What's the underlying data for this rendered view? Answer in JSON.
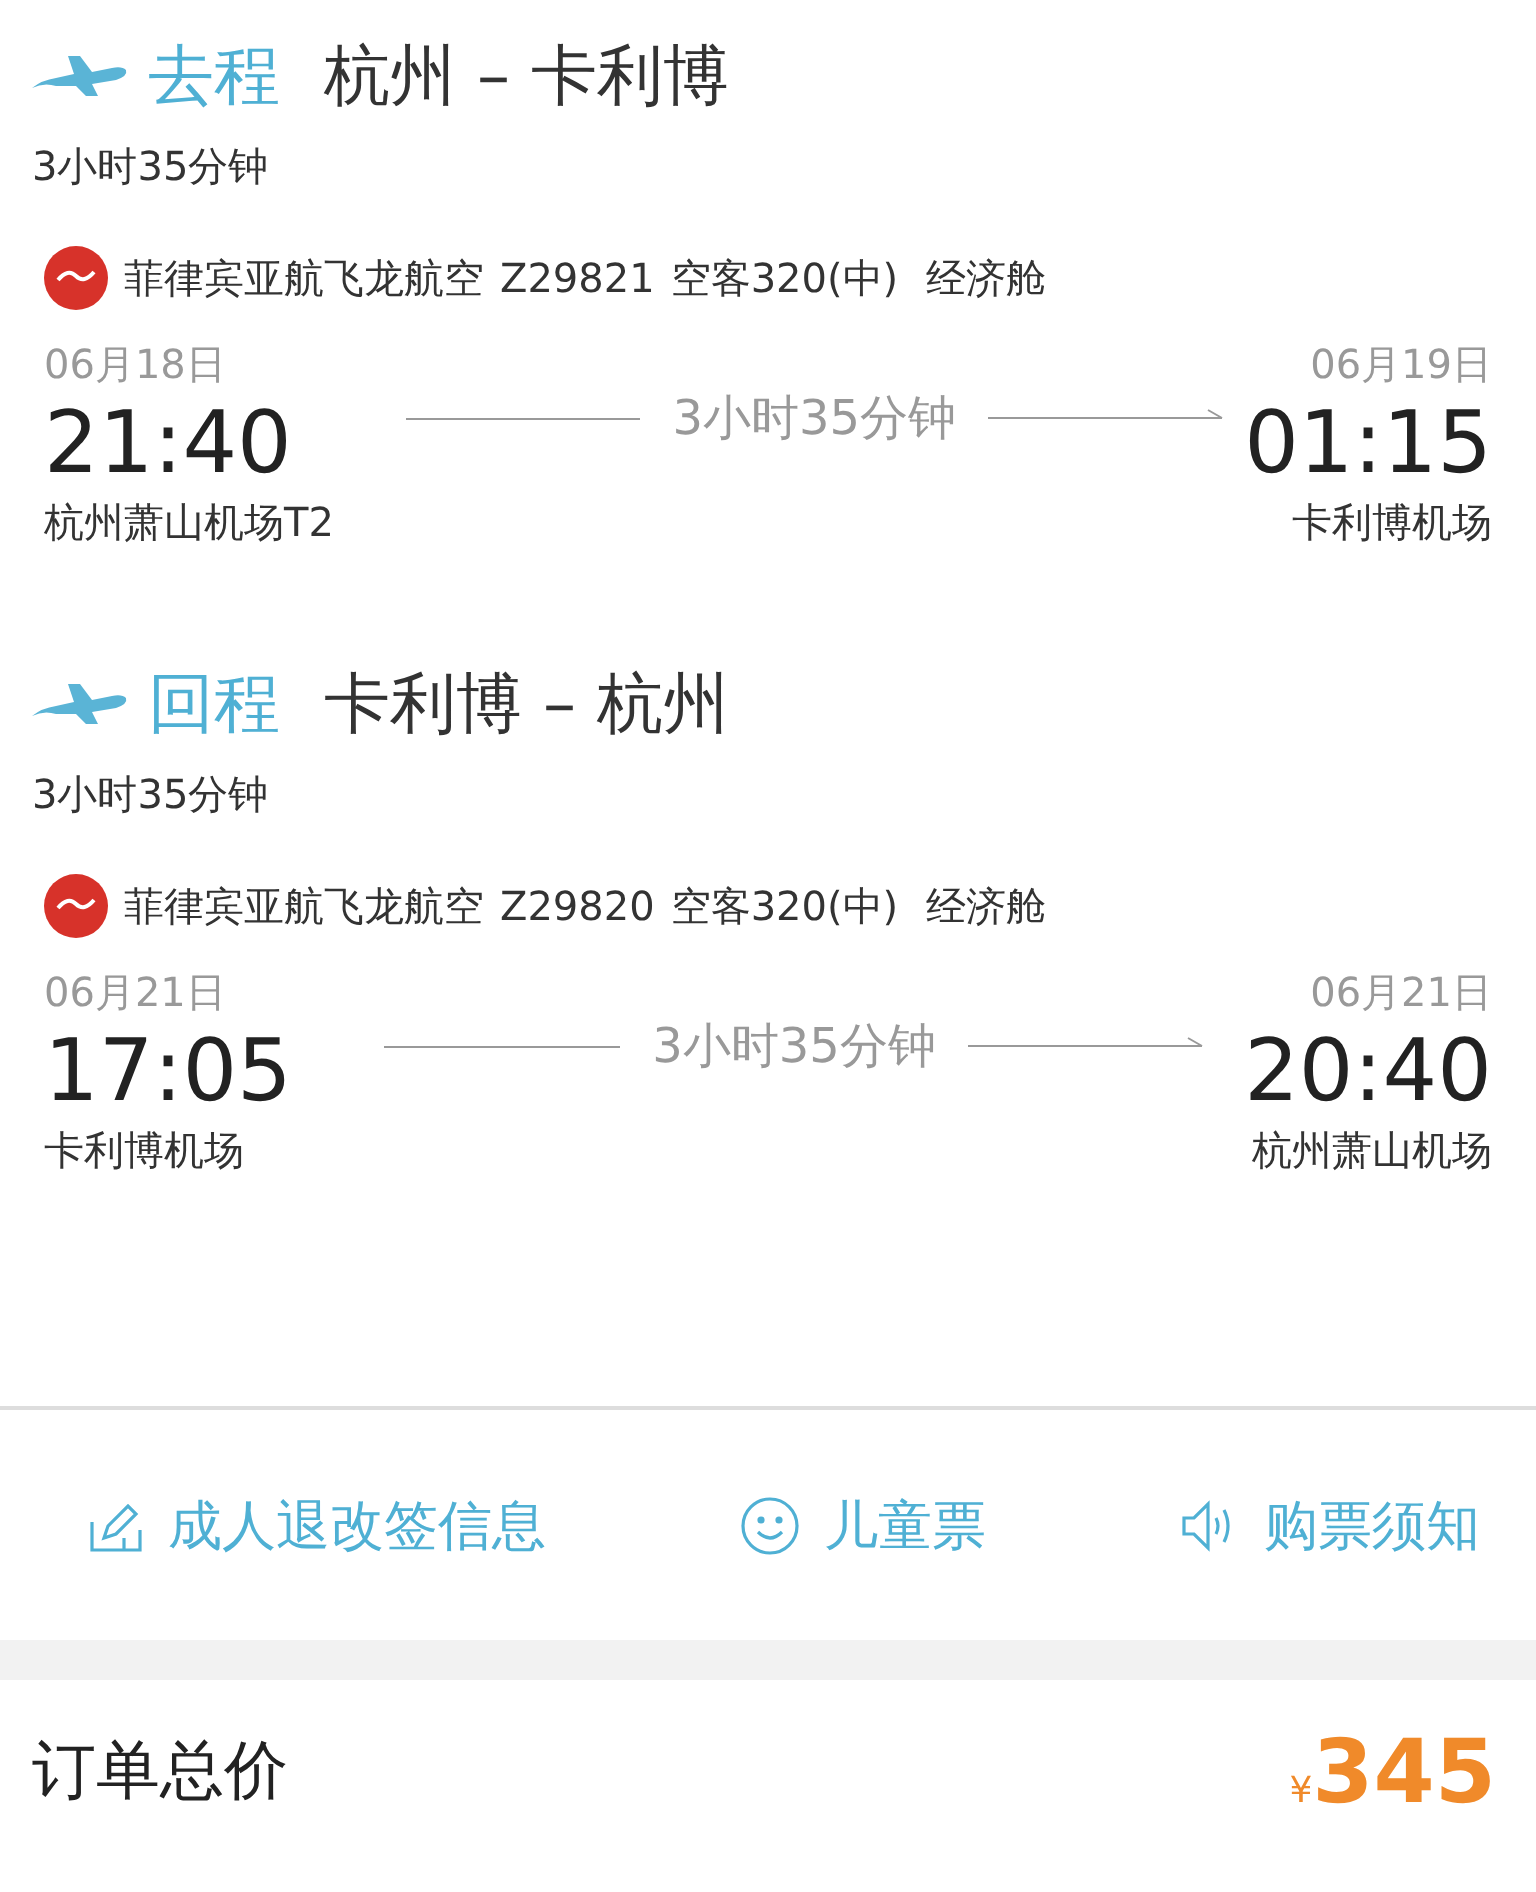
{
  "legs": [
    {
      "label": "去程",
      "route": "杭州 – 卡利博",
      "duration": "3小时35分钟",
      "airline": "菲律宾亚航飞龙航空",
      "flight_no": "Z29821",
      "aircraft": "空客320(中)",
      "cabin": "经济舱",
      "depart": {
        "date": "06月18日",
        "time": "21:40",
        "airport": "杭州萧山机场T2"
      },
      "arrive": {
        "date": "06月19日",
        "time": "01:15",
        "airport": "卡利博机场"
      },
      "flight_time": "3小时35分钟"
    },
    {
      "label": "回程",
      "route": "卡利博 – 杭州",
      "duration": "3小时35分钟",
      "airline": "菲律宾亚航飞龙航空",
      "flight_no": "Z29820",
      "aircraft": "空客320(中)",
      "cabin": "经济舱",
      "depart": {
        "date": "06月21日",
        "time": "17:05",
        "airport": "卡利博机场"
      },
      "arrive": {
        "date": "06月21日",
        "time": "20:40",
        "airport": "杭州萧山机场"
      },
      "flight_time": "3小时35分钟"
    }
  ],
  "links": [
    {
      "kind": "rules",
      "label": "成人退改签信息"
    },
    {
      "kind": "child",
      "label": "儿童票"
    },
    {
      "kind": "notice",
      "label": "购票须知"
    }
  ],
  "total": {
    "label": "订单总价",
    "currency": "¥",
    "amount": "345"
  }
}
